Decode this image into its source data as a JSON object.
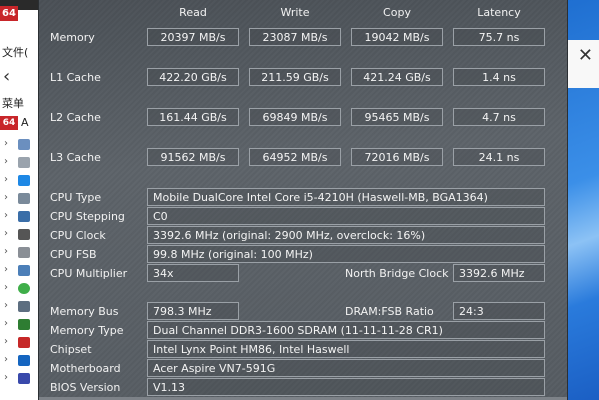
{
  "background": {
    "logo": "64",
    "menu_file": "文件(",
    "menu_cai": "菜单",
    "row_logo": "64",
    "row_letter": "A",
    "back_icon": "chevron-left-icon",
    "close_icon": "close-icon"
  },
  "headers": {
    "read": "Read",
    "write": "Write",
    "copy": "Copy",
    "latency": "Latency"
  },
  "benchmarks": [
    {
      "label": "Memory",
      "read": "20397 MB/s",
      "write": "23087 MB/s",
      "copy": "19042 MB/s",
      "latency": "75.7 ns"
    },
    {
      "label": "L1 Cache",
      "read": "422.20 GB/s",
      "write": "211.59 GB/s",
      "copy": "421.24 GB/s",
      "latency": "1.4 ns"
    },
    {
      "label": "L2 Cache",
      "read": "161.44 GB/s",
      "write": "69849 MB/s",
      "copy": "95465 MB/s",
      "latency": "4.7 ns"
    },
    {
      "label": "L3 Cache",
      "read": "91562 MB/s",
      "write": "64952 MB/s",
      "copy": "72016 MB/s",
      "latency": "24.1 ns"
    }
  ],
  "cpu": {
    "type_label": "CPU Type",
    "type_value": "Mobile DualCore Intel Core i5-4210H  (Haswell-MB, BGA1364)",
    "stepping_label": "CPU Stepping",
    "stepping_value": "C0",
    "clock_label": "CPU Clock",
    "clock_value": "3392.6 MHz  (original: 2900 MHz, overclock: 16%)",
    "fsb_label": "CPU FSB",
    "fsb_value": "99.8 MHz  (original: 100 MHz)",
    "multiplier_label": "CPU Multiplier",
    "multiplier_value": "34x",
    "nb_clock_label": "North Bridge Clock",
    "nb_clock_value": "3392.6 MHz"
  },
  "memory": {
    "bus_label": "Memory Bus",
    "bus_value": "798.3 MHz",
    "ratio_label": "DRAM:FSB Ratio",
    "ratio_value": "24:3",
    "type_label": "Memory Type",
    "type_value": "Dual Channel DDR3-1600 SDRAM  (11-11-11-28 CR1)",
    "chipset_label": "Chipset",
    "chipset_value": "Intel Lynx Point HM86, Intel Haswell",
    "motherboard_label": "Motherboard",
    "motherboard_value": "Acer Aspire VN7-591G",
    "bios_label": "BIOS Version",
    "bios_value": "V1.13"
  }
}
